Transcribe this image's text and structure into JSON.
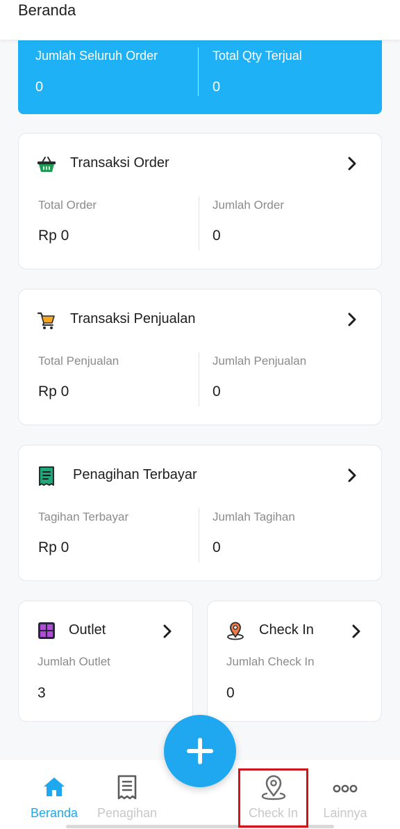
{
  "header": {
    "title": "Beranda"
  },
  "summary": {
    "left": {
      "label": "Jumlah Seluruh Order",
      "value": "0"
    },
    "right": {
      "label": "Total Qty Terjual",
      "value": "0"
    }
  },
  "cards": {
    "order": {
      "title": "Transaksi Order",
      "left_label": "Total Order",
      "left_value": "Rp 0",
      "right_label": "Jumlah Order",
      "right_value": "0"
    },
    "sales": {
      "title": "Transaksi Penjualan",
      "left_label": "Total Penjualan",
      "left_value": "Rp 0",
      "right_label": "Jumlah Penjualan",
      "right_value": "0"
    },
    "billing": {
      "title": "Penagihan Terbayar",
      "left_label": "Tagihan Terbayar",
      "left_value": "Rp 0",
      "right_label": "Jumlah Tagihan",
      "right_value": "0"
    },
    "outlet": {
      "title": "Outlet",
      "label": "Jumlah Outlet",
      "value": "3"
    },
    "checkin": {
      "title": "Check In",
      "label": "Jumlah Check In",
      "value": "0"
    }
  },
  "nav": {
    "home": "Beranda",
    "billing": "Penagihan",
    "checkin": "Check In",
    "more": "Lainnya"
  },
  "icons": {
    "order": "basket-icon",
    "sales": "cart-icon",
    "billing": "receipt-icon",
    "outlet": "store-icon",
    "checkin": "location-pin-icon",
    "fab": "plus-icon"
  },
  "colors": {
    "accent": "#1fa8ef",
    "summary_bg": "#1fb1f5",
    "highlight": "#d0141c",
    "nav_inactive": "#c8c8c8"
  }
}
